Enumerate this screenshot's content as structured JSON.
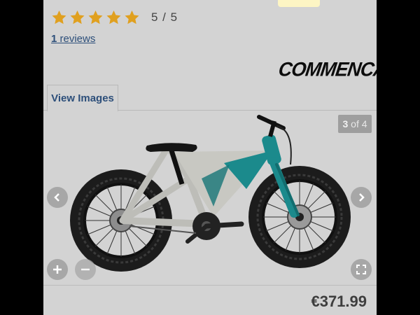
{
  "rating": {
    "stars": 5,
    "text": "5 / 5",
    "star_color": "#e0a01f"
  },
  "reviews": {
    "count": "1",
    "label": "reviews"
  },
  "brand": {
    "logo_text": "COMMENCAL"
  },
  "tabs": [
    {
      "label": "View Images"
    }
  ],
  "gallery": {
    "current": "3",
    "of_label": "of",
    "total": "4"
  },
  "icons": {
    "prev": "chevron-left-icon",
    "next": "chevron-right-icon",
    "zoom_in": "plus-icon",
    "zoom_out": "minus-icon",
    "fullscreen": "fullscreen-icon"
  },
  "product": {
    "price": "€371.99",
    "frame_color": "#1b8a8c"
  }
}
